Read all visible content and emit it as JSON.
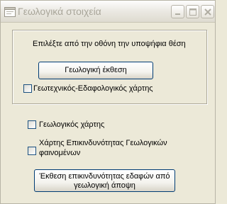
{
  "window": {
    "title": "Γεωλογικά στοιχεία",
    "controls": {
      "minimize": "minimize",
      "maximize": "maximize",
      "close": "close"
    }
  },
  "selection_group": {
    "prompt": "Επιλέξτε από την οθόνη την υποψήφια θέση",
    "geology_report_button": "Γεωλογική έκθεση",
    "geotech_checkbox": {
      "label": "Γεωτεχνικός-Εδαφολογικός χάρτης",
      "checked": false
    }
  },
  "geology_map_checkbox": {
    "label": "Γεωλογικός χάρτης",
    "checked": false
  },
  "hazard_map_checkbox": {
    "label_line1": "Χάρτης Επικινδυνότητας Γεωλογικών",
    "label_line2": "φαινομένων",
    "checked": false
  },
  "hazard_report_button": {
    "line1": "Έκθεση επικινδυνότητας εδαφών από",
    "line2": "γεωλογική άποψη"
  },
  "colors": {
    "face": "#ece9d8",
    "button_border": "#003c74",
    "checkbox_border": "#1c5180"
  }
}
